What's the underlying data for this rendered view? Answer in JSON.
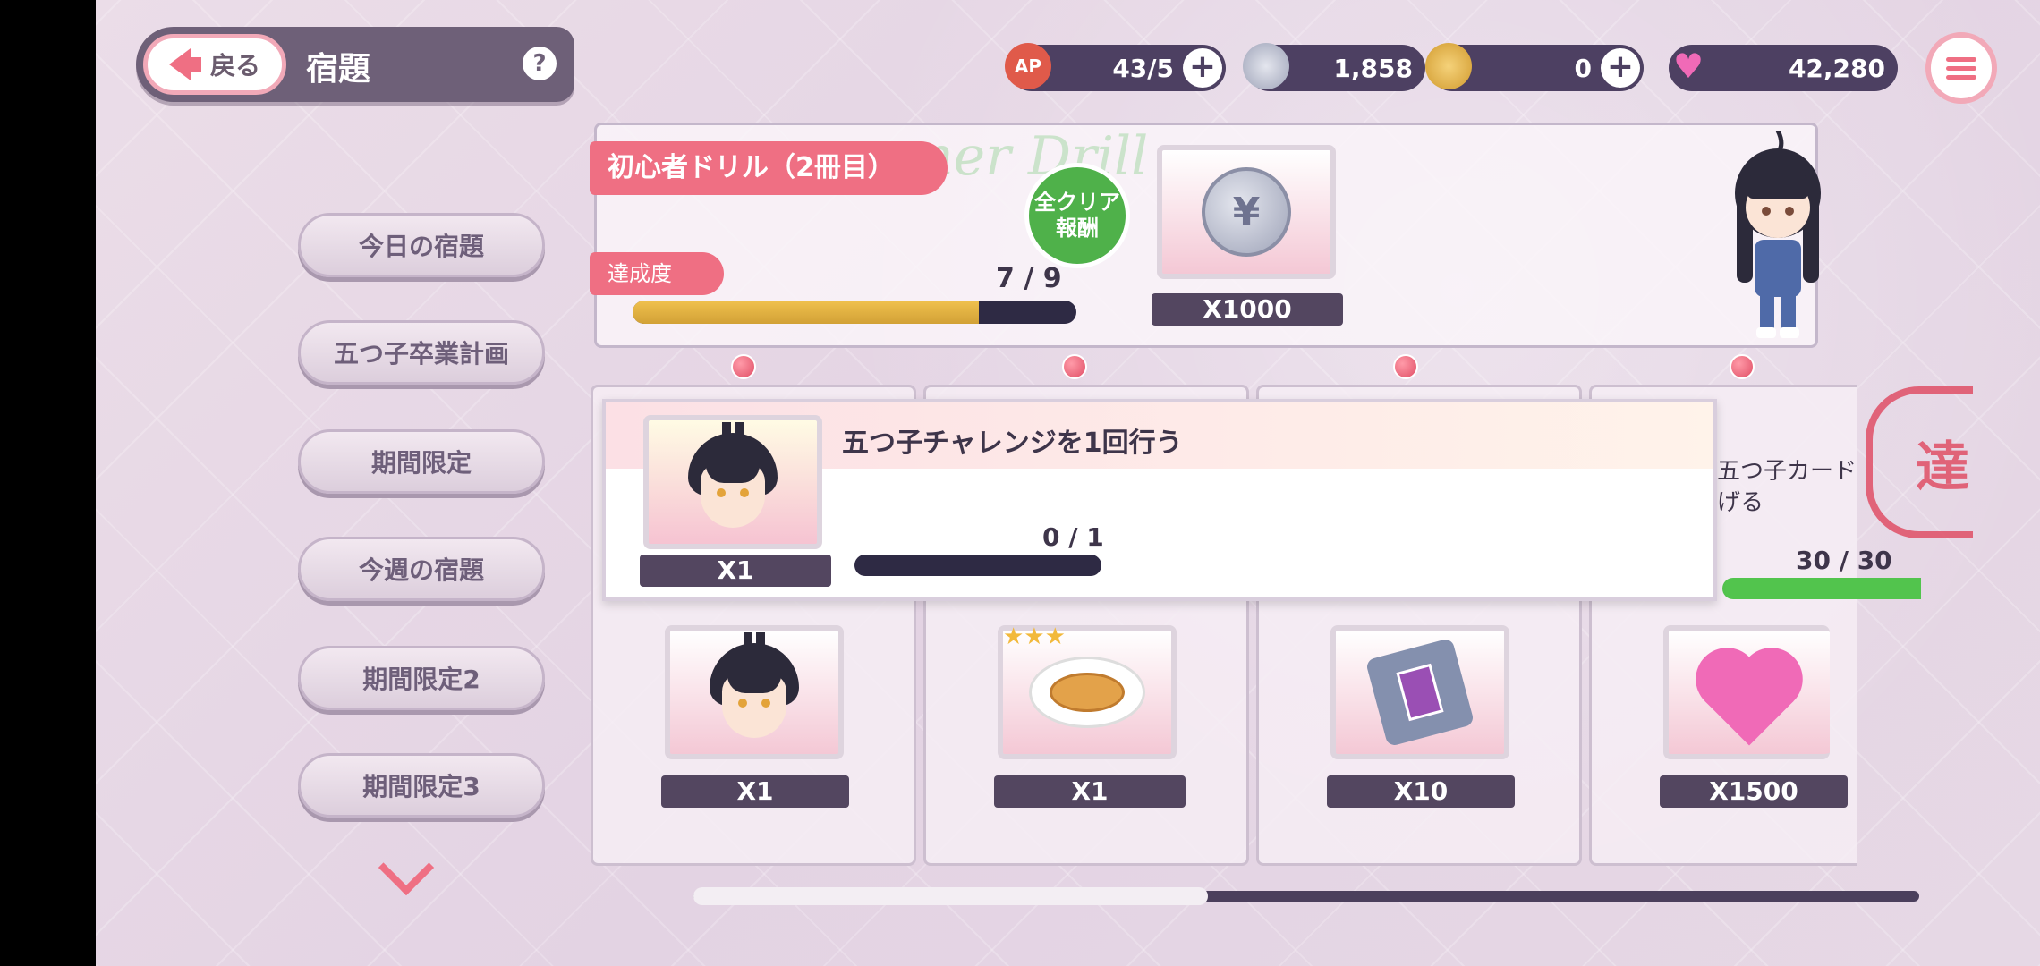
{
  "header": {
    "back_label": "戻る",
    "title": "宿題",
    "help_label": "?"
  },
  "currencies": [
    {
      "name": "ap",
      "icon_text": "AP",
      "value": "43/5",
      "has_plus": true,
      "color": "#e05a4a"
    },
    {
      "name": "silver-coin",
      "icon_text": "",
      "value": "1,858",
      "has_plus": false,
      "color": "#b4b8c8"
    },
    {
      "name": "gold-coin",
      "icon_text": "",
      "value": "0",
      "has_plus": true,
      "color": "#e1b04a"
    },
    {
      "name": "heart-gem",
      "icon_text": "",
      "value": "42,280",
      "has_plus": false,
      "color": "#f06ab7"
    }
  ],
  "sidebar": {
    "items": [
      {
        "label": "今日の宿題"
      },
      {
        "label": "五つ子卒業計画"
      },
      {
        "label": "期間限定"
      },
      {
        "label": "今週の宿題"
      },
      {
        "label": "期間限定2"
      },
      {
        "label": "期間限定3"
      }
    ]
  },
  "drill": {
    "title": "初心者ドリル（2冊目）",
    "bg_text": "ner Drill",
    "all_clear_line1": "全クリア",
    "all_clear_line2": "報酬",
    "progress_label": "達成度",
    "progress_count": "7 / 9",
    "progress_value": 0.78,
    "reward_qty": "X1000"
  },
  "task_cards": [
    {
      "qty": "X1"
    },
    {
      "qty": "X1"
    },
    {
      "qty": "X10"
    },
    {
      "qty": "X1500",
      "partial_text_1": "五つ子カード",
      "partial_text_2": "げる",
      "count": "30 / 30",
      "stamp": "達"
    }
  ],
  "popup": {
    "task_text": "五つ子チャレンジを1回行う",
    "item_qty": "X1",
    "count": "0 / 1",
    "progress_value": 0
  },
  "scroll_thumb_fraction": 0.42
}
